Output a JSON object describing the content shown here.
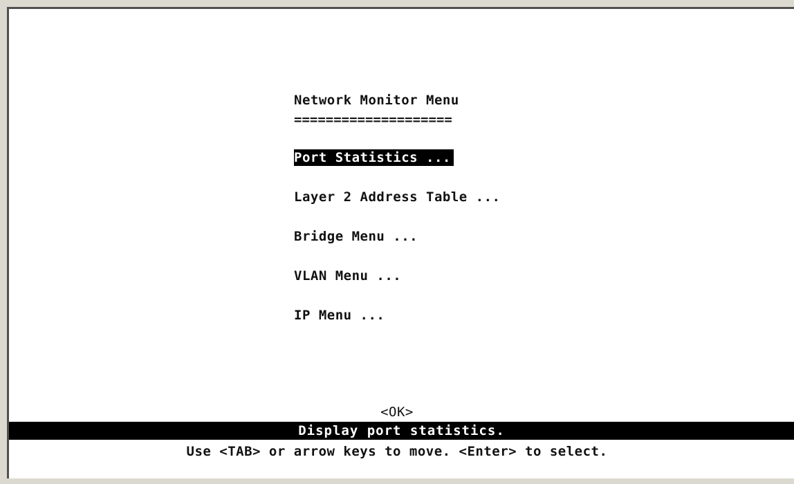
{
  "menu": {
    "title": "Network Monitor Menu",
    "rule": "====================",
    "items": [
      {
        "label": "Port Statistics ...",
        "selected": true
      },
      {
        "label": "Layer 2 Address Table ...",
        "selected": false
      },
      {
        "label": "Bridge Menu ...",
        "selected": false
      },
      {
        "label": "VLAN Menu ...",
        "selected": false
      },
      {
        "label": "IP Menu ...",
        "selected": false
      }
    ]
  },
  "ok_button": "<OK>",
  "status": "Display port statistics.",
  "help": "Use <TAB> or arrow keys to move. <Enter> to select.",
  "colors": {
    "background": "#ffffff",
    "text": "#111111",
    "highlight_bg": "#000000",
    "highlight_fg": "#ffffff"
  }
}
